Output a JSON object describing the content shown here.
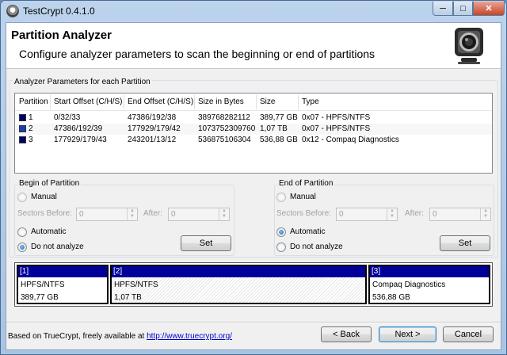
{
  "window": {
    "title": "TestCrypt 0.4.1.0"
  },
  "header": {
    "title": "Partition Analyzer",
    "subtitle": "Configure analyzer parameters to scan the beginning or end of partitions"
  },
  "params_group": {
    "label": "Analyzer Parameters for each Partition"
  },
  "table": {
    "columns": [
      "Partition",
      "Start Offset (C/H/S)",
      "End Offset (C/H/S)",
      "Size in Bytes",
      "Size",
      "Type"
    ],
    "rows": [
      {
        "partition": "1",
        "start": "0/32/33",
        "end": "47386/192/38",
        "bytes": "389768282112",
        "size": "389,77 GB",
        "type": "0x07 - HPFS/NTFS",
        "color": "#000066"
      },
      {
        "partition": "2",
        "start": "47386/192/39",
        "end": "177929/179/42",
        "bytes": "1073752309760",
        "size": "1,07 TB",
        "type": "0x07 - HPFS/NTFS",
        "color": "#1a3fb0"
      },
      {
        "partition": "3",
        "start": "177929/179/43",
        "end": "243201/13/12",
        "bytes": "536875106304",
        "size": "536,88 GB",
        "type": "0x12 - Compaq Diagnostics",
        "color": "#000066"
      }
    ]
  },
  "begin": {
    "label": "Begin of Partition",
    "manual": "Manual",
    "sectors_before": "Sectors Before:",
    "before_value": "0",
    "after": "After:",
    "after_value": "0",
    "automatic": "Automatic",
    "do_not_analyze": "Do not analyze",
    "selected": "do_not_analyze",
    "set": "Set"
  },
  "end": {
    "label": "End of Partition",
    "manual": "Manual",
    "sectors_before": "Sectors Before:",
    "before_value": "0",
    "after": "After:",
    "after_value": "0",
    "automatic": "Automatic",
    "do_not_analyze": "Do not analyze",
    "selected": "automatic",
    "set": "Set"
  },
  "map": [
    {
      "id": "[1]",
      "fs": "HPFS/NTFS",
      "size": "389,77 GB"
    },
    {
      "id": "[2]",
      "fs": "HPFS/NTFS",
      "size": "1,07 TB"
    },
    {
      "id": "[3]",
      "fs": "Compaq Diagnostics",
      "size": "536,88 GB"
    }
  ],
  "footer": {
    "text": "Based on TrueCrypt, freely available at ",
    "link": "http://www.truecrypt.org/",
    "back": "< Back",
    "next": "Next >",
    "cancel": "Cancel"
  },
  "icons": [
    "app-icon",
    "webcam-logo-icon",
    "minimize-icon",
    "maximize-icon",
    "close-icon"
  ]
}
